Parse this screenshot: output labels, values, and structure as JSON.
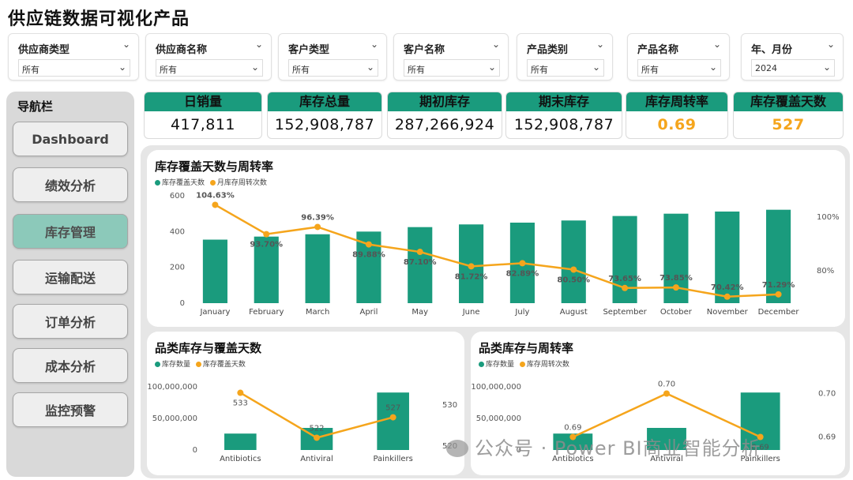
{
  "title": "供应链数据可视化产品",
  "filters": [
    {
      "label": "供应商类型",
      "value": "所有"
    },
    {
      "label": "供应商名称",
      "value": "所有"
    },
    {
      "label": "客户类型",
      "value": "所有"
    },
    {
      "label": "客户名称",
      "value": "所有"
    },
    {
      "label": "产品类别",
      "value": "所有"
    },
    {
      "label": "产品名称",
      "value": "所有"
    },
    {
      "label": "年、月份",
      "value": "2024"
    }
  ],
  "nav": {
    "title": "导航栏",
    "items": [
      {
        "label": "Dashboard"
      },
      {
        "label": "绩效分析"
      },
      {
        "label": "库存管理",
        "active": true
      },
      {
        "label": "运输配送"
      },
      {
        "label": "订单分析"
      },
      {
        "label": "成本分析"
      },
      {
        "label": "监控预警"
      }
    ]
  },
  "kpis": [
    {
      "label": "日销量",
      "value": "417,811"
    },
    {
      "label": "库存总量",
      "value": "152,908,787"
    },
    {
      "label": "期初库存",
      "value": "287,266,924"
    },
    {
      "label": "期末库存",
      "value": "152,908,787"
    },
    {
      "label": "库存周转率",
      "value": "0.69"
    },
    {
      "label": "库存覆盖天数",
      "value": "527"
    }
  ],
  "colors": {
    "bar": "#1a9b7d",
    "line": "#f5a51c",
    "kpi_head": "#1a9b7d",
    "nav_active": "#8cc9ba",
    "highlight": "#f5a51c"
  },
  "watermark": "公众号 · Power BI商业智能分析",
  "chart_data": [
    {
      "type": "bar+line",
      "title": "库存覆盖天数与周转率",
      "categories": [
        "January",
        "February",
        "March",
        "April",
        "May",
        "June",
        "July",
        "August",
        "September",
        "October",
        "November",
        "December"
      ],
      "series": [
        {
          "name": "库存覆盖天数",
          "type": "bar",
          "axis": "left",
          "values": [
            355,
            372,
            385,
            400,
            425,
            440,
            450,
            462,
            487,
            500,
            512,
            522
          ]
        },
        {
          "name": "月库存周转次数",
          "type": "line",
          "axis": "right",
          "values": [
            104.63,
            93.7,
            96.39,
            89.88,
            87.1,
            81.72,
            82.89,
            80.5,
            73.65,
            73.85,
            70.42,
            71.29
          ],
          "labels": [
            "104.63%",
            "93.70%",
            "96.39%",
            "89.88%",
            "87.10%",
            "81.72%",
            "82.89%",
            "80.50%",
            "73.65%",
            "73.85%",
            "70.42%",
            "71.29%"
          ]
        }
      ],
      "ylim_left": [
        0,
        600
      ],
      "yticks_left": [
        "0",
        "200",
        "400",
        "600"
      ],
      "ylim_right": [
        68,
        108
      ],
      "yticks_right": [
        "80%",
        "100%"
      ]
    },
    {
      "type": "bar+line",
      "title": "品类库存与覆盖天数",
      "categories": [
        "Antibiotics",
        "Antiviral",
        "Painkillers"
      ],
      "series": [
        {
          "name": "库存数量",
          "type": "bar",
          "axis": "left",
          "values": [
            26000000,
            35000000,
            91000000
          ]
        },
        {
          "name": "库存覆盖天数",
          "type": "line",
          "axis": "right",
          "values": [
            533,
            522,
            527
          ],
          "labels": [
            "533",
            "522",
            "527"
          ]
        }
      ],
      "ylim_left": [
        0,
        110000000
      ],
      "yticks_left": [
        "0",
        "50,000,000",
        "100,000,000"
      ],
      "ylim_right": [
        519,
        536
      ],
      "yticks_right": [
        "520",
        "530"
      ]
    },
    {
      "type": "bar+line",
      "title": "品类库存与周转率",
      "categories": [
        "Antibiotics",
        "Antiviral",
        "Painkillers"
      ],
      "series": [
        {
          "name": "库存数量",
          "type": "bar",
          "axis": "left",
          "values": [
            26000000,
            35000000,
            91000000
          ]
        },
        {
          "name": "库存周转次数",
          "type": "line",
          "axis": "right",
          "values": [
            0.69,
            0.7,
            0.69
          ],
          "labels": [
            "0.69",
            "0.70",
            "0.69"
          ]
        }
      ],
      "ylim_left": [
        0,
        110000000
      ],
      "yticks_left": [
        "0",
        "50,000,000",
        "100,000,000"
      ],
      "ylim_right": [
        0.687,
        0.703
      ],
      "yticks_right": [
        "0.69",
        "0.70"
      ]
    }
  ]
}
